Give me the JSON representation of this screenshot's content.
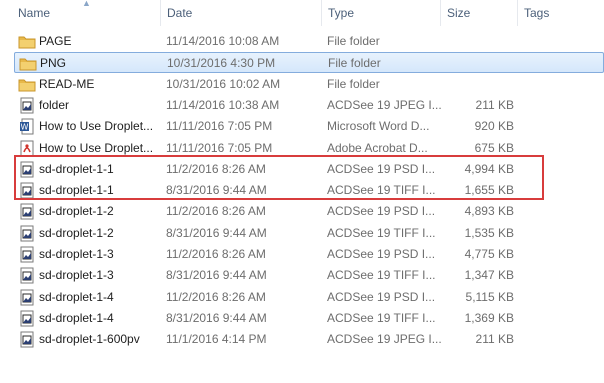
{
  "columns": {
    "name": "Name",
    "date": "Date",
    "type": "Type",
    "size": "Size",
    "tags": "Tags"
  },
  "colors": {
    "highlight": "#d83c3c",
    "folder": "#e8b94a",
    "selected_border": "#84acdd"
  },
  "rows": [
    {
      "icon": "folder-icon",
      "name": "PAGE",
      "date": "11/14/2016 10:08 AM",
      "type": "File folder",
      "size": ""
    },
    {
      "icon": "folder-icon",
      "name": "PNG",
      "date": "10/31/2016 4:30 PM",
      "type": "File folder",
      "size": ""
    },
    {
      "icon": "folder-icon",
      "name": "READ-ME",
      "date": "10/31/2016 10:02 AM",
      "type": "File folder",
      "size": ""
    },
    {
      "icon": "image-file-icon",
      "name": "folder",
      "date": "11/14/2016 10:38 AM",
      "type": "ACDSee 19 JPEG I...",
      "size": "211 KB"
    },
    {
      "icon": "word-file-icon",
      "name": "How to Use Droplet...",
      "date": "11/11/2016 7:05 PM",
      "type": "Microsoft Word D...",
      "size": "920 KB"
    },
    {
      "icon": "pdf-file-icon",
      "name": "How to Use Droplet...",
      "date": "11/11/2016 7:05 PM",
      "type": "Adobe Acrobat D...",
      "size": "675 KB"
    },
    {
      "icon": "image-file-icon",
      "name": "sd-droplet-1-1",
      "date": "11/2/2016 8:26 AM",
      "type": "ACDSee 19 PSD I...",
      "size": "4,994 KB"
    },
    {
      "icon": "image-file-icon",
      "name": "sd-droplet-1-1",
      "date": "8/31/2016 9:44 AM",
      "type": "ACDSee 19 TIFF I...",
      "size": "1,655 KB"
    },
    {
      "icon": "image-file-icon",
      "name": "sd-droplet-1-2",
      "date": "11/2/2016 8:26 AM",
      "type": "ACDSee 19 PSD I...",
      "size": "4,893 KB"
    },
    {
      "icon": "image-file-icon",
      "name": "sd-droplet-1-2",
      "date": "8/31/2016 9:44 AM",
      "type": "ACDSee 19 TIFF I...",
      "size": "1,535 KB"
    },
    {
      "icon": "image-file-icon",
      "name": "sd-droplet-1-3",
      "date": "11/2/2016 8:26 AM",
      "type": "ACDSee 19 PSD I...",
      "size": "4,775 KB"
    },
    {
      "icon": "image-file-icon",
      "name": "sd-droplet-1-3",
      "date": "8/31/2016 9:44 AM",
      "type": "ACDSee 19 TIFF I...",
      "size": "1,347 KB"
    },
    {
      "icon": "image-file-icon",
      "name": "sd-droplet-1-4",
      "date": "11/2/2016 8:26 AM",
      "type": "ACDSee 19 PSD I...",
      "size": "5,115 KB"
    },
    {
      "icon": "image-file-icon",
      "name": "sd-droplet-1-4",
      "date": "8/31/2016 9:44 AM",
      "type": "ACDSee 19 TIFF I...",
      "size": "1,369 KB"
    },
    {
      "icon": "image-file-icon",
      "name": "sd-droplet-1-600pv",
      "date": "11/1/2016 4:14 PM",
      "type": "ACDSee 19 JPEG I...",
      "size": "211 KB"
    }
  ]
}
